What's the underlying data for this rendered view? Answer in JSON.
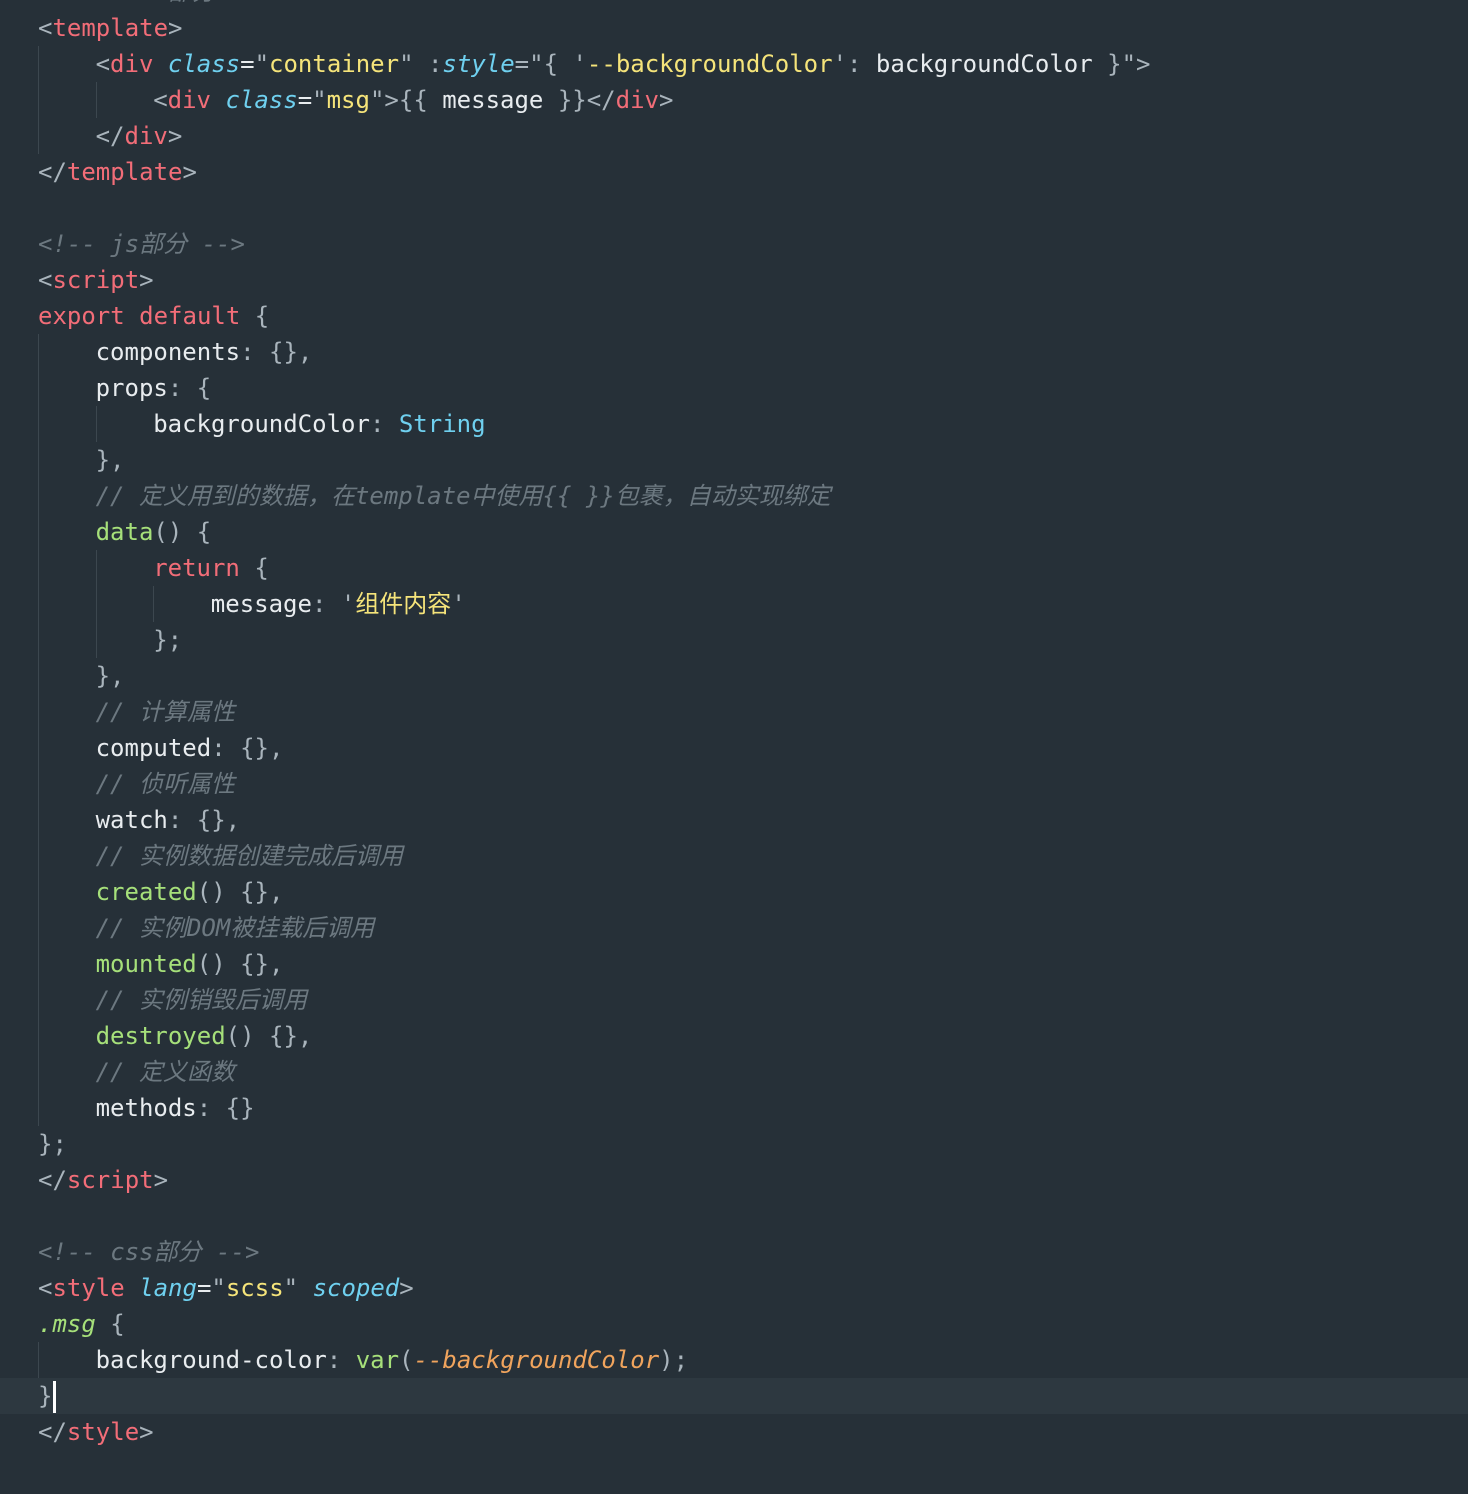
{
  "editor": {
    "language": "vue",
    "cursor": {
      "line": 39
    },
    "colors": {
      "background": "#263038",
      "current_line": "#2d3840",
      "tag": "#f26d78",
      "attribute": "#6fd0ef",
      "string": "#f5e47a",
      "comment": "#6c7880",
      "function": "#a6e07a",
      "css_variable": "#f0a45d"
    },
    "lines": [
      {
        "indent": 0,
        "tokens": [
          {
            "t": "com",
            "v": "<!-- html部分 -->"
          }
        ]
      },
      {
        "indent": 0,
        "tokens": [
          {
            "t": "punc",
            "v": "<"
          },
          {
            "t": "tag",
            "v": "template"
          },
          {
            "t": "punc",
            "v": ">"
          }
        ]
      },
      {
        "indent": 1,
        "tokens": [
          {
            "t": "punc",
            "v": "<"
          },
          {
            "t": "tag",
            "v": "div"
          },
          {
            "t": "plain",
            "v": " "
          },
          {
            "t": "attr",
            "v": "class"
          },
          {
            "t": "plain",
            "v": "="
          },
          {
            "t": "strq",
            "v": "\""
          },
          {
            "t": "str",
            "v": "container"
          },
          {
            "t": "strq",
            "v": "\""
          },
          {
            "t": "plain",
            "v": " "
          },
          {
            "t": "punc",
            "v": ":"
          },
          {
            "t": "attr",
            "v": "style"
          },
          {
            "t": "punc",
            "v": "=\"{ "
          },
          {
            "t": "strq",
            "v": "'"
          },
          {
            "t": "str",
            "v": "--backgroundColor"
          },
          {
            "t": "strq",
            "v": "'"
          },
          {
            "t": "punc",
            "v": ": "
          },
          {
            "t": "plain",
            "v": "backgroundColor"
          },
          {
            "t": "punc",
            "v": " }\">"
          }
        ]
      },
      {
        "indent": 2,
        "tokens": [
          {
            "t": "punc",
            "v": "<"
          },
          {
            "t": "tag",
            "v": "div"
          },
          {
            "t": "plain",
            "v": " "
          },
          {
            "t": "attr",
            "v": "class"
          },
          {
            "t": "plain",
            "v": "="
          },
          {
            "t": "strq",
            "v": "\""
          },
          {
            "t": "str",
            "v": "msg"
          },
          {
            "t": "strq",
            "v": "\""
          },
          {
            "t": "punc",
            "v": ">{{ "
          },
          {
            "t": "plain",
            "v": "message"
          },
          {
            "t": "punc",
            "v": " }}</"
          },
          {
            "t": "tag",
            "v": "div"
          },
          {
            "t": "punc",
            "v": ">"
          }
        ]
      },
      {
        "indent": 1,
        "tokens": [
          {
            "t": "punc",
            "v": "</"
          },
          {
            "t": "tag",
            "v": "div"
          },
          {
            "t": "punc",
            "v": ">"
          }
        ]
      },
      {
        "indent": 0,
        "tokens": [
          {
            "t": "punc",
            "v": "</"
          },
          {
            "t": "tag",
            "v": "template"
          },
          {
            "t": "punc",
            "v": ">"
          }
        ]
      },
      {
        "indent": 0,
        "tokens": []
      },
      {
        "indent": 0,
        "tokens": [
          {
            "t": "com",
            "v": "<!-- js部分 -->"
          }
        ]
      },
      {
        "indent": 0,
        "tokens": [
          {
            "t": "punc",
            "v": "<"
          },
          {
            "t": "tag",
            "v": "script"
          },
          {
            "t": "punc",
            "v": ">"
          }
        ]
      },
      {
        "indent": 0,
        "tokens": [
          {
            "t": "kw",
            "v": "export"
          },
          {
            "t": "plain",
            "v": " "
          },
          {
            "t": "kw",
            "v": "default"
          },
          {
            "t": "plain",
            "v": " "
          },
          {
            "t": "punc",
            "v": "{"
          }
        ]
      },
      {
        "indent": 1,
        "tokens": [
          {
            "t": "prop",
            "v": "components"
          },
          {
            "t": "punc",
            "v": ": {},"
          }
        ]
      },
      {
        "indent": 1,
        "tokens": [
          {
            "t": "prop",
            "v": "props"
          },
          {
            "t": "punc",
            "v": ": {"
          }
        ]
      },
      {
        "indent": 2,
        "tokens": [
          {
            "t": "prop",
            "v": "backgroundColor"
          },
          {
            "t": "punc",
            "v": ": "
          },
          {
            "t": "type",
            "v": "String"
          }
        ]
      },
      {
        "indent": 1,
        "tokens": [
          {
            "t": "punc",
            "v": "},"
          }
        ]
      },
      {
        "indent": 1,
        "tokens": [
          {
            "t": "com",
            "v": "// 定义用到的数据，在template中使用{{ }}包裹，自动实现绑定"
          }
        ]
      },
      {
        "indent": 1,
        "tokens": [
          {
            "t": "fn",
            "v": "data"
          },
          {
            "t": "punc",
            "v": "() {"
          }
        ]
      },
      {
        "indent": 2,
        "tokens": [
          {
            "t": "kw",
            "v": "return"
          },
          {
            "t": "plain",
            "v": " "
          },
          {
            "t": "punc",
            "v": "{"
          }
        ]
      },
      {
        "indent": 3,
        "tokens": [
          {
            "t": "prop",
            "v": "message"
          },
          {
            "t": "punc",
            "v": ": "
          },
          {
            "t": "strq",
            "v": "'"
          },
          {
            "t": "str",
            "v": "组件内容"
          },
          {
            "t": "strq",
            "v": "'"
          }
        ]
      },
      {
        "indent": 2,
        "tokens": [
          {
            "t": "punc",
            "v": "};"
          }
        ]
      },
      {
        "indent": 1,
        "tokens": [
          {
            "t": "punc",
            "v": "},"
          }
        ]
      },
      {
        "indent": 1,
        "tokens": [
          {
            "t": "com",
            "v": "// 计算属性"
          }
        ]
      },
      {
        "indent": 1,
        "tokens": [
          {
            "t": "prop",
            "v": "computed"
          },
          {
            "t": "punc",
            "v": ": {},"
          }
        ]
      },
      {
        "indent": 1,
        "tokens": [
          {
            "t": "com",
            "v": "// 侦听属性"
          }
        ]
      },
      {
        "indent": 1,
        "tokens": [
          {
            "t": "prop",
            "v": "watch"
          },
          {
            "t": "punc",
            "v": ": {},"
          }
        ]
      },
      {
        "indent": 1,
        "tokens": [
          {
            "t": "com",
            "v": "// 实例数据创建完成后调用"
          }
        ]
      },
      {
        "indent": 1,
        "tokens": [
          {
            "t": "fn",
            "v": "created"
          },
          {
            "t": "punc",
            "v": "() {},"
          }
        ]
      },
      {
        "indent": 1,
        "tokens": [
          {
            "t": "com",
            "v": "// 实例DOM被挂载后调用"
          }
        ]
      },
      {
        "indent": 1,
        "tokens": [
          {
            "t": "fn",
            "v": "mounted"
          },
          {
            "t": "punc",
            "v": "() {},"
          }
        ]
      },
      {
        "indent": 1,
        "tokens": [
          {
            "t": "com",
            "v": "// 实例销毁后调用"
          }
        ]
      },
      {
        "indent": 1,
        "tokens": [
          {
            "t": "fn",
            "v": "destroyed"
          },
          {
            "t": "punc",
            "v": "() {},"
          }
        ]
      },
      {
        "indent": 1,
        "tokens": [
          {
            "t": "com",
            "v": "// 定义函数"
          }
        ]
      },
      {
        "indent": 1,
        "tokens": [
          {
            "t": "prop",
            "v": "methods"
          },
          {
            "t": "punc",
            "v": ": {}"
          }
        ]
      },
      {
        "indent": 0,
        "tokens": [
          {
            "t": "punc",
            "v": "};"
          }
        ]
      },
      {
        "indent": 0,
        "tokens": [
          {
            "t": "punc",
            "v": "</"
          },
          {
            "t": "tag",
            "v": "script"
          },
          {
            "t": "punc",
            "v": ">"
          }
        ]
      },
      {
        "indent": 0,
        "tokens": []
      },
      {
        "indent": 0,
        "tokens": [
          {
            "t": "com",
            "v": "<!-- css部分 -->"
          }
        ]
      },
      {
        "indent": 0,
        "tokens": [
          {
            "t": "punc",
            "v": "<"
          },
          {
            "t": "tag",
            "v": "style"
          },
          {
            "t": "plain",
            "v": " "
          },
          {
            "t": "attr",
            "v": "lang"
          },
          {
            "t": "plain",
            "v": "="
          },
          {
            "t": "strq",
            "v": "\""
          },
          {
            "t": "str",
            "v": "scss"
          },
          {
            "t": "strq",
            "v": "\""
          },
          {
            "t": "plain",
            "v": " "
          },
          {
            "t": "attr",
            "v": "scoped"
          },
          {
            "t": "punc",
            "v": ">"
          }
        ]
      },
      {
        "indent": 0,
        "tokens": [
          {
            "t": "sel",
            "v": ".msg"
          },
          {
            "t": "plain",
            "v": " "
          },
          {
            "t": "punc",
            "v": "{"
          }
        ]
      },
      {
        "indent": 1,
        "tokens": [
          {
            "t": "prop",
            "v": "background-color"
          },
          {
            "t": "punc",
            "v": ": "
          },
          {
            "t": "fn",
            "v": "var"
          },
          {
            "t": "punc",
            "v": "("
          },
          {
            "t": "var",
            "v": "--backgroundColor"
          },
          {
            "t": "punc",
            "v": ");"
          }
        ]
      },
      {
        "indent": 0,
        "tokens": [
          {
            "t": "punc",
            "v": "}"
          }
        ]
      },
      {
        "indent": 0,
        "tokens": [
          {
            "t": "punc",
            "v": "</"
          },
          {
            "t": "tag",
            "v": "style"
          },
          {
            "t": "punc",
            "v": ">"
          }
        ]
      }
    ]
  }
}
